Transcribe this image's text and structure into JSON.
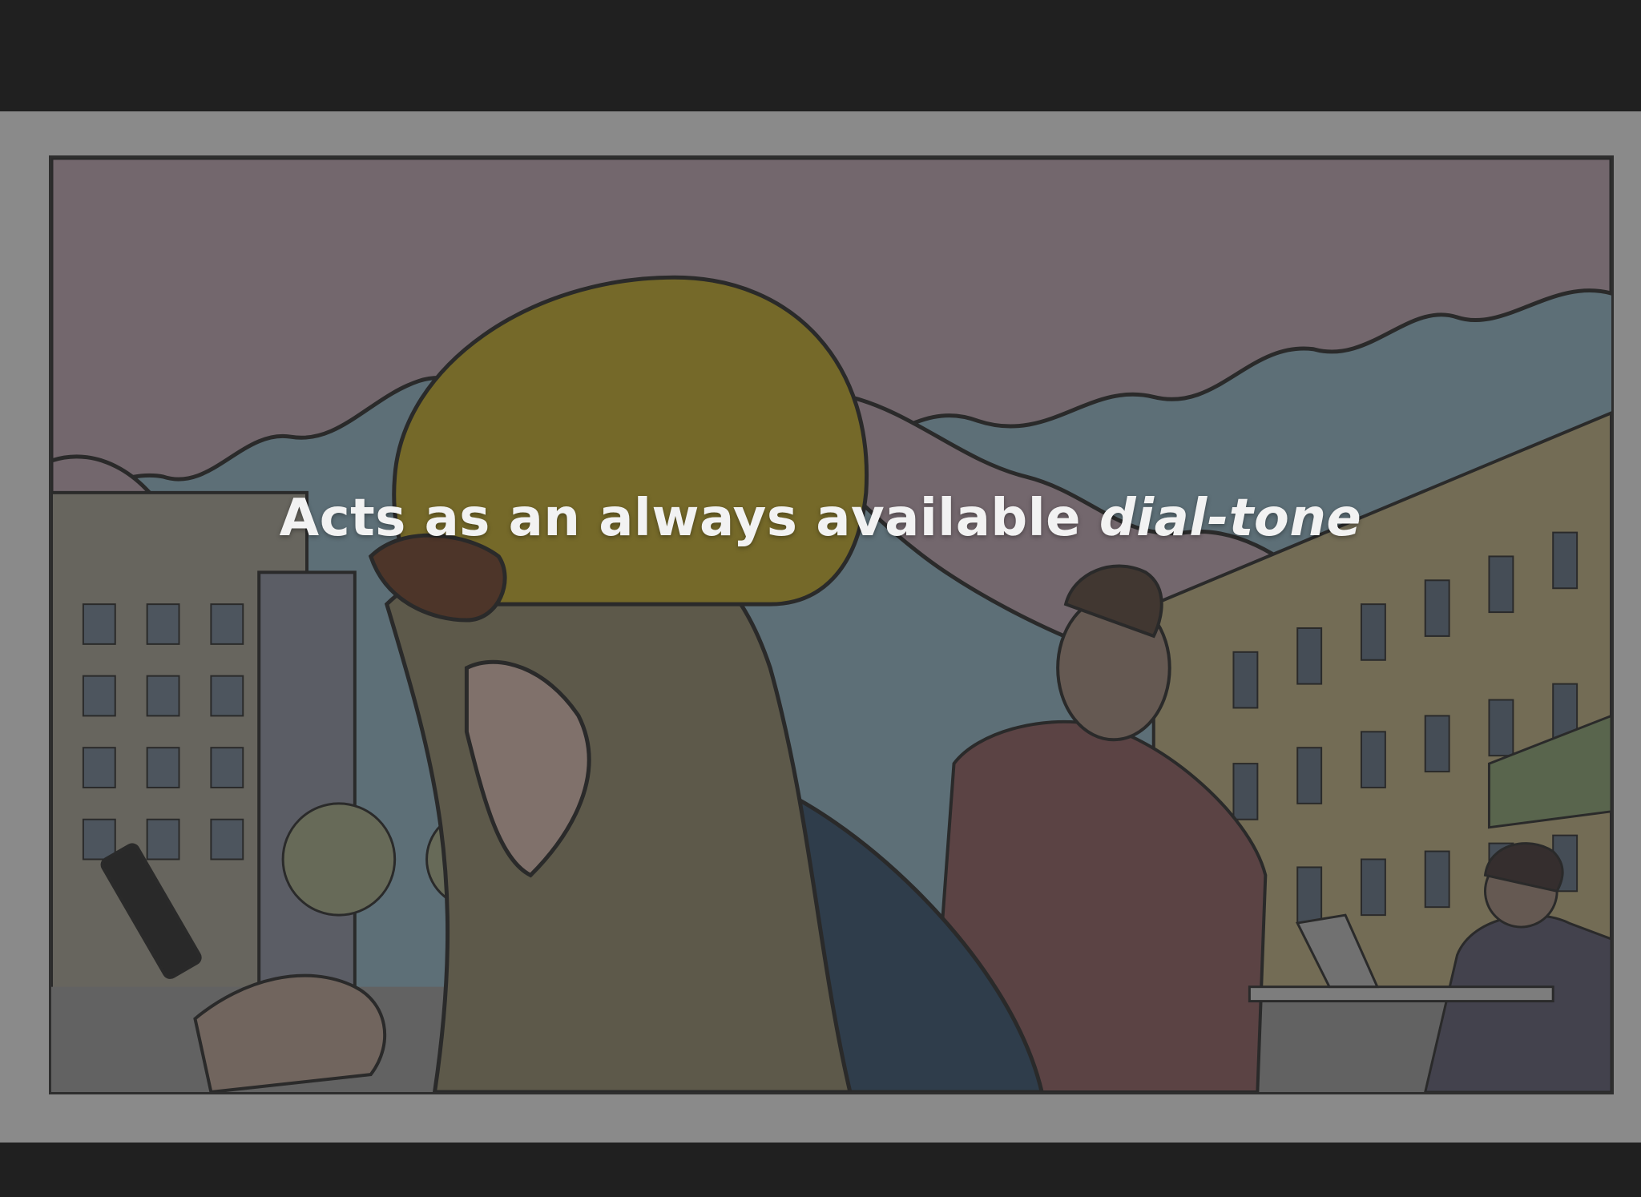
{
  "slide": {
    "caption_text": "Acts as an always available",
    "caption_emphasis": "dial-tone"
  },
  "illustration": {
    "subject": "comic-style street scene with people using phones",
    "icon": "comic-illustration-image"
  },
  "colors": {
    "background": "#202020",
    "slide_frame": "#8a8a8a",
    "caption": "#f2f2f2"
  }
}
